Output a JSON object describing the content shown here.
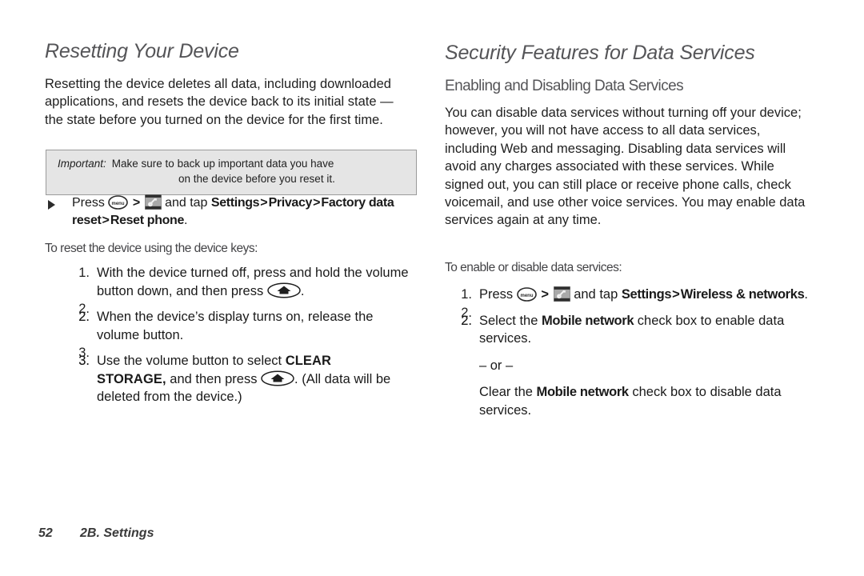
{
  "left_column": {
    "chapter_heading": "Resetting Your Device",
    "intro_paragraph": "Resetting the device deletes all data, including downloaded applications, and resets the device back to its initial state — the state before you turned on the device for the first time.",
    "callout": {
      "label": "Important:",
      "line1": "Make sure to back up important data you have",
      "line2": "on the device before you reset it."
    },
    "bullet_step": {
      "press_word": "Press",
      "separator": ">",
      "and_tap_word": "and tap",
      "ui_path_1": "Settings",
      "ui_path_2": "Privacy",
      "ui_path_3": "Factory data reset",
      "ui_path_4": "Reset phone",
      "period": "."
    },
    "lead_in": "To reset the device using the device keys:",
    "steps": [
      {
        "pre": "With the device turned off, press and hold the volume button down, and then press",
        "post": "."
      },
      {
        "pre": "When the device’s display turns on, release the volume button.",
        "post": ""
      },
      {
        "pre": "Use the volume button to select",
        "emphasis": "CLEAR STORAGE,",
        "mid": "and then press",
        "post": ". (All data will be deleted from the device.)"
      }
    ]
  },
  "right_column": {
    "chapter_heading": "Security Features for Data Services",
    "section_heading": "Enabling and Disabling Data Services",
    "intro_paragraph": "You can disable data services without turning off your device; however, you will not have access to all data services, including Web and messaging. Disabling data services will avoid any charges associated with these services. While signed out, you can still place or receive phone calls, check voicemail, and use other voice services. You may enable data services again at any time.",
    "lead_in": "To enable or disable data services:",
    "step1": {
      "press_word": "Press",
      "separator": ">",
      "and_tap_word": "and tap",
      "ui_path_1": "Settings",
      "ui_path_2": "Wireless & networks",
      "period": "."
    },
    "step2": {
      "pre": "Select the",
      "emphasis": "Mobile network",
      "post": "check box to enable data services.",
      "or_divider": "– or –",
      "alt_pre": "Clear the",
      "alt_emphasis": "Mobile network",
      "alt_post": "check box to disable data services."
    }
  },
  "footer": {
    "page_number": "52",
    "section_label": "2B. Settings"
  },
  "icons": {
    "menu_key": "menu",
    "menu_key_name": "menu-key-icon",
    "home_key_name": "home-key-icon",
    "settings_name": "settings-app-icon"
  },
  "colors": {
    "heading": "#555558",
    "body_text": "#1f1f1f",
    "callout_bg": "#e5e5e5",
    "callout_border": "#9b9b9b"
  }
}
